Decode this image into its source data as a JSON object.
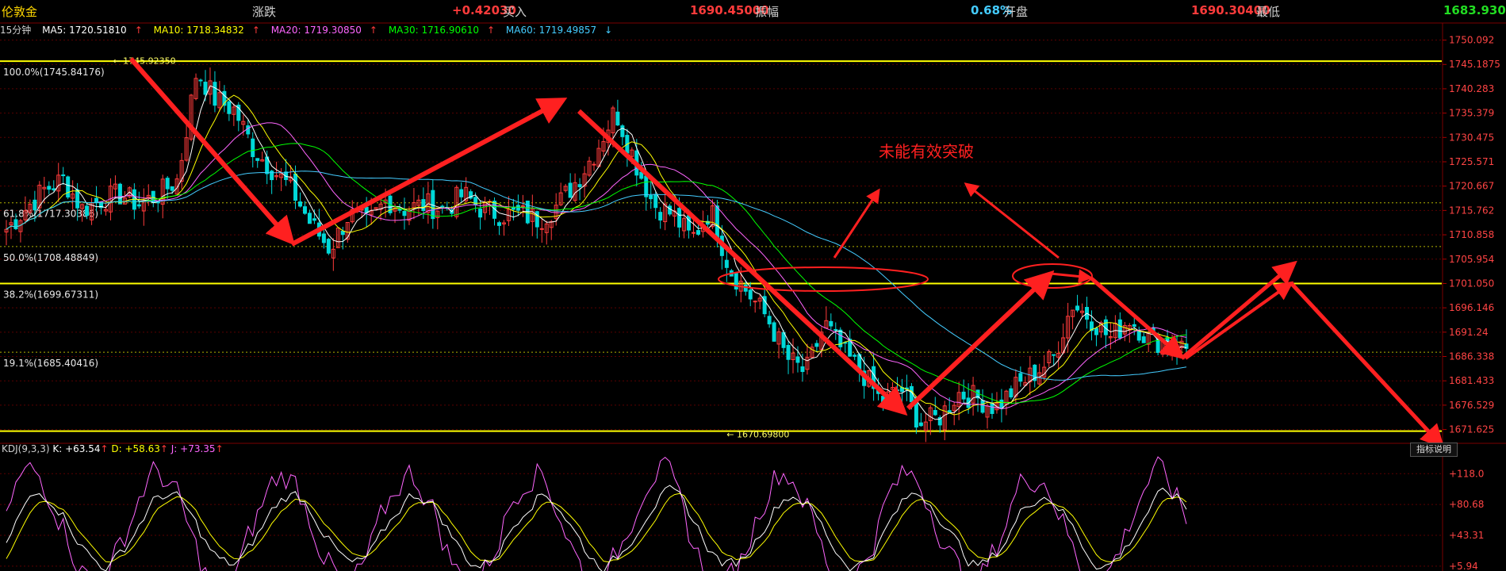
{
  "header": {
    "symbol": "伦敦金",
    "change_label": "涨跌",
    "change_value": "+0.42030",
    "bid_label": "买入",
    "bid_value": "1690.45000",
    "amplitude_label": "振幅",
    "amplitude_value": "0.68%",
    "open_label": "开盘",
    "open_value": "1690.30400",
    "low_label": "最低",
    "low_value": "1683.93000"
  },
  "ma_row": {
    "period": "15分钟",
    "ma5": "MA5: 1720.51810",
    "ma10": "MA10: 1718.34832",
    "ma20": "MA20: 1719.30850",
    "ma30": "MA30: 1716.90610",
    "ma60": "MA60: 1719.49857",
    "up_arrow": "↑",
    "down_arrow": "↓"
  },
  "colors": {
    "up": "#ff3b3b",
    "down": "#00d8d8",
    "ma5": "#ffffff",
    "ma10": "#ffff00",
    "ma20": "#ff66ff",
    "ma30": "#00ff00",
    "ma60": "#44ccff",
    "fib": "#ffff00",
    "annotation": "#ff2020"
  },
  "chart_data": [
    {
      "type": "candlestick",
      "title": "伦敦金 15分钟",
      "ylim": [
        1669.0,
        1750.5
      ],
      "y_ticks": [
        "1750.092",
        "1745.1875",
        "1740.283",
        "1735.379",
        "1730.475",
        "1725.571",
        "1720.667",
        "1715.762",
        "1710.858",
        "1705.954",
        "1701.050",
        "1696.146",
        "1691.24",
        "1686.338",
        "1681.433",
        "1676.529",
        "1671.625"
      ],
      "fib_levels": [
        {
          "label": "100.0%(1745.84176)",
          "value": 1745.84176,
          "bold": true
        },
        {
          "label": "61.8%(1717.30386)",
          "value": 1717.30386,
          "bold": false
        },
        {
          "label": "50.0%(1708.48849)",
          "value": 1708.48849,
          "bold": false
        },
        {
          "label": "38.2%(1699.67311)",
          "value": 1701.05,
          "bold": true
        },
        {
          "label": "19.1%(1685.40416)",
          "value": 1687.2,
          "bold": false
        },
        {
          "label": "",
          "value": 1671.3,
          "bold": true
        }
      ],
      "extremes": [
        {
          "label": "1745.92350",
          "index": 0.085,
          "value": 1745.92
        },
        {
          "label": "1670.69800",
          "index": 0.605,
          "value": 1670.7
        }
      ],
      "close_path": [
        1712,
        1716,
        1720,
        1722,
        1716,
        1718,
        1719,
        1717,
        1719,
        1722,
        1744,
        1738,
        1736,
        1728,
        1724,
        1720,
        1713,
        1708,
        1715,
        1713,
        1718,
        1716,
        1717,
        1716,
        1719,
        1716,
        1715,
        1715,
        1714,
        1717,
        1722,
        1728,
        1736,
        1726,
        1717,
        1715,
        1710,
        1716,
        1704,
        1699,
        1694,
        1686,
        1683,
        1693,
        1687,
        1683,
        1677,
        1680,
        1673,
        1674,
        1679,
        1678,
        1676,
        1680,
        1683,
        1686,
        1697,
        1694,
        1690,
        1694,
        1690,
        1689,
        1688
      ]
    },
    {
      "type": "line",
      "title": "KDJ(9,3,3)",
      "series": [
        {
          "name": "K",
          "value": "+63.54"
        },
        {
          "name": "D",
          "value": "+58.63"
        },
        {
          "name": "J",
          "value": "+73.35"
        }
      ],
      "ylim": [
        0,
        125
      ],
      "y_ticks": [
        "+118.0",
        "+80.68",
        "+43.31",
        "+5.94"
      ],
      "y_tick_values": [
        118.0,
        80.68,
        43.31,
        5.94
      ]
    }
  ],
  "annotation_text": "未能有效突破",
  "explain_label": "指标说明"
}
